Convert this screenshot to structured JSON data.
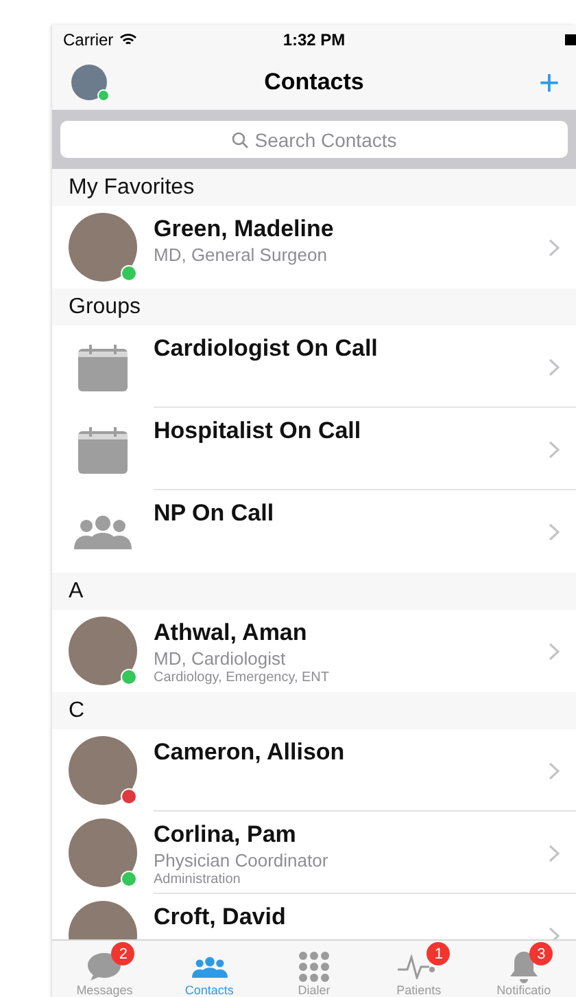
{
  "status_bar": {
    "carrier": "Carrier",
    "time": "1:32 PM"
  },
  "nav": {
    "title": "Contacts",
    "add": "+",
    "profile": {
      "color": "#34c759"
    }
  },
  "search": {
    "placeholder": "Search Contacts"
  },
  "sections": [
    {
      "title": "My Favorites",
      "rows": [
        {
          "kind": "person",
          "name": "Green, Madeline",
          "subtitle": "MD, General Surgeon",
          "color": "#34c759"
        }
      ]
    },
    {
      "title": "Groups",
      "rows": [
        {
          "kind": "calendar",
          "name": "Cardiologist On Call"
        },
        {
          "kind": "calendar",
          "name": "Hospitalist On Call"
        },
        {
          "kind": "people",
          "name": "NP On Call"
        }
      ]
    },
    {
      "title": "A",
      "rows": [
        {
          "kind": "person",
          "name": "Athwal, Aman",
          "subtitle": "MD, Cardiologist",
          "detail": "Cardiology, Emergency, ENT",
          "color": "#34c759"
        }
      ]
    },
    {
      "title": "C",
      "rows": [
        {
          "kind": "person",
          "name": "Cameron, Allison",
          "color": "#e0383e"
        },
        {
          "kind": "person",
          "name": "Corlina, Pam",
          "subtitle": "Physician Coordinator",
          "detail": "Administration",
          "color": "#34c759"
        },
        {
          "kind": "person",
          "name": "Croft, David"
        }
      ]
    }
  ],
  "tabs": [
    {
      "kind": "chat",
      "label": "Messages",
      "badge": "2",
      "selected": false
    },
    {
      "kind": "people",
      "label": "Contacts",
      "selected": true
    },
    {
      "kind": "dots",
      "label": "Dialer",
      "selected": false
    },
    {
      "kind": "pulse",
      "label": "Patients",
      "badge": "1",
      "selected": false
    },
    {
      "kind": "bell",
      "label": "Notificatio",
      "badge": "3",
      "selected": false
    }
  ]
}
